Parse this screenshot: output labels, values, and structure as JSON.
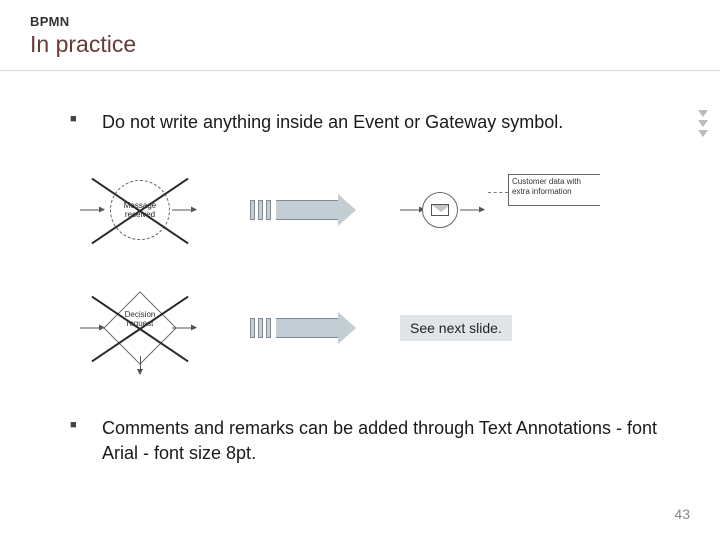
{
  "header": {
    "kicker": "BPMN",
    "title": "In practice"
  },
  "bullets": {
    "b1": "Do not write anything inside an Event or Gateway symbol.",
    "b2": "Comments and remarks can be added through Text Annotations - font Arial - font size 8pt."
  },
  "diagrams": {
    "wrong_event": {
      "line1": "Message",
      "line2": "received"
    },
    "wrong_gateway": {
      "line1": "Decision",
      "line2": "request"
    },
    "annotation_text": "Customer data with extra information",
    "see_next": "See next slide."
  },
  "page_number": "43"
}
